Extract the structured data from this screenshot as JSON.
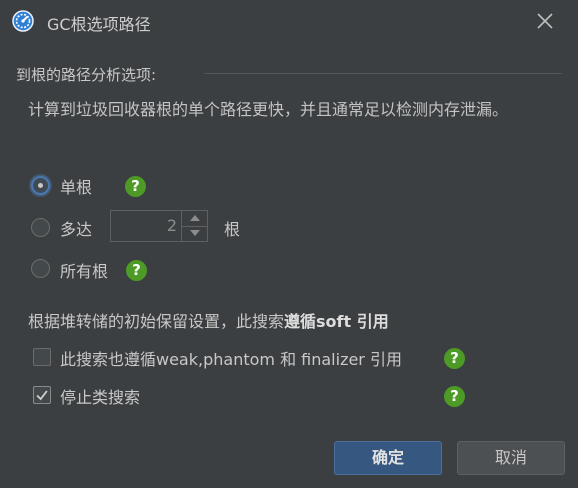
{
  "window": {
    "title": "GC根选项路径",
    "app_icon": "gauge-icon",
    "close_icon": "close-icon"
  },
  "group": {
    "label": "到根的路径分析选项:"
  },
  "description": "计算到垃圾回收器根的单个路径更快，并且通常足以检测内存泄漏。",
  "options": {
    "single_root": {
      "label": "单根",
      "selected": true
    },
    "up_to": {
      "label": "多达",
      "value": "2",
      "suffix": "根",
      "selected": false
    },
    "all_roots": {
      "label": "所有根",
      "selected": false
    }
  },
  "retain": {
    "prefix": "根据堆转储的初始保留设置，此搜索",
    "bold": "遵循soft 引用"
  },
  "checks": {
    "weak_phantom": {
      "label": "此搜索也遵循weak,phantom 和 finalizer 引用",
      "checked": false
    },
    "stop_class": {
      "label": "停止类搜索",
      "checked": true
    }
  },
  "help_glyph": "?",
  "buttons": {
    "ok": "确定",
    "cancel": "取消"
  },
  "colors": {
    "background": "#3c3f41",
    "accent": "#4a78b5",
    "help": "#4e9a27",
    "primary_button": "#365880"
  }
}
